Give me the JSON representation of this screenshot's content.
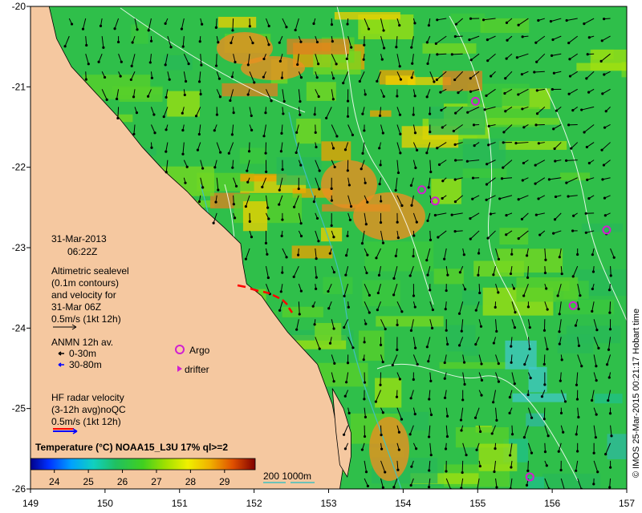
{
  "map": {
    "lon_range": [
      149,
      157
    ],
    "lat_range": [
      -26,
      -20
    ],
    "x_ticks": [
      "149",
      "150",
      "151",
      "152",
      "153",
      "154",
      "155",
      "156",
      "157"
    ],
    "y_ticks": [
      "-20",
      "-21",
      "-22",
      "-23",
      "-24",
      "-25",
      "-26"
    ]
  },
  "legend": {
    "date": "31-Mar-2013",
    "time": "06:22Z",
    "altimetry_lines": [
      "Altimetric sealevel",
      "(0.1m contours)",
      "and velocity for",
      "31-Mar 06Z",
      "0.5m/s (1kt 12h)"
    ],
    "anmn_title": "ANMN 12h av.",
    "anmn_items": [
      "0-30m",
      "30-80m"
    ],
    "anmn_colors": [
      "#000000",
      "#0000ff"
    ],
    "argo_label": "Argo",
    "drifter_label": "drifter",
    "hf_lines": [
      "HF radar velocity",
      "(3-12h avg)noQC",
      "0.5m/s (1kt 12h)"
    ],
    "colorbar_title": "Temperature (°C) NOAA15_L3U 17% ql>=2",
    "colorbar_ticks": [
      "24",
      "25",
      "26",
      "27",
      "28",
      "29"
    ],
    "contour_label": "200  1000m",
    "credit": "© IMOS 25-Mar-2015 00:21:17 Hobart time"
  },
  "colors": {
    "land": "#f5c8a0",
    "contour": "#40c0c0",
    "argo": "#d020d0",
    "drifter": "#d020d0",
    "hf_red": "#ff0000",
    "hf_blue": "#0000ff"
  },
  "argo_floats": [
    {
      "lon": 154.97,
      "lat": -21.18
    },
    {
      "lon": 154.25,
      "lat": -22.28
    },
    {
      "lon": 154.43,
      "lat": -22.42
    },
    {
      "lon": 156.73,
      "lat": -22.78
    },
    {
      "lon": 156.28,
      "lat": -23.72
    },
    {
      "lon": 155.7,
      "lat": -25.85
    }
  ],
  "coastline": [
    [
      149.25,
      -20.0
    ],
    [
      149.35,
      -20.4
    ],
    [
      149.55,
      -20.75
    ],
    [
      149.8,
      -21.0
    ],
    [
      150.2,
      -21.4
    ],
    [
      150.5,
      -21.75
    ],
    [
      150.8,
      -22.05
    ],
    [
      151.1,
      -22.3
    ],
    [
      151.3,
      -22.5
    ],
    [
      151.6,
      -22.75
    ],
    [
      151.82,
      -22.95
    ],
    [
      151.85,
      -23.2
    ],
    [
      151.9,
      -23.45
    ],
    [
      152.1,
      -23.6
    ],
    [
      152.25,
      -23.8
    ],
    [
      152.45,
      -24.05
    ],
    [
      152.65,
      -24.25
    ],
    [
      152.85,
      -24.45
    ],
    [
      152.95,
      -24.7
    ],
    [
      153.05,
      -24.95
    ],
    [
      153.1,
      -25.2
    ],
    [
      153.15,
      -25.45
    ],
    [
      153.2,
      -25.7
    ],
    [
      153.15,
      -26.0
    ]
  ],
  "fraser_island": [
    [
      153.05,
      -24.75
    ],
    [
      153.2,
      -25.0
    ],
    [
      153.3,
      -25.3
    ],
    [
      153.3,
      -25.6
    ],
    [
      153.25,
      -25.85
    ],
    [
      153.15,
      -25.7
    ],
    [
      153.1,
      -25.3
    ]
  ]
}
